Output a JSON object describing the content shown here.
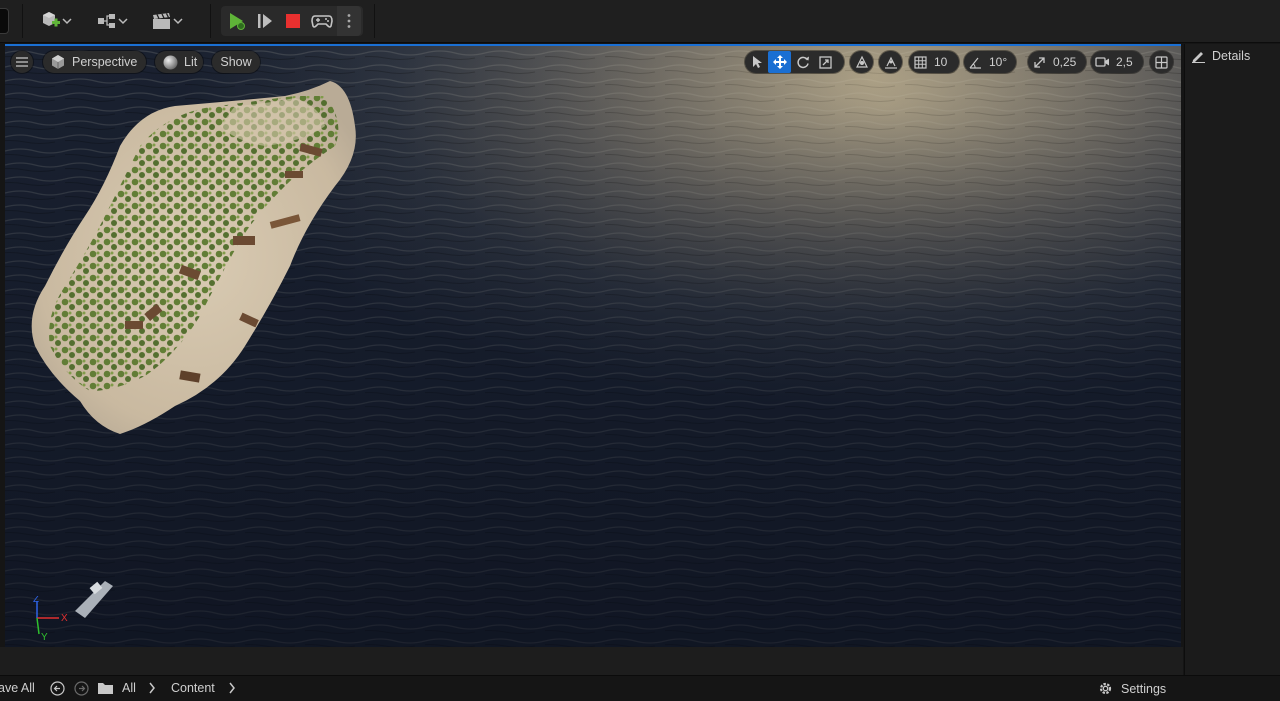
{
  "toolbar": {
    "play_group_icons": [
      "play-icon",
      "advance-frame-icon",
      "stop-icon",
      "gamepad-icon",
      "more-options-icon"
    ]
  },
  "viewport": {
    "perspective_label": "Perspective",
    "lit_label": "Lit",
    "show_label": "Show",
    "grid_snap_value": "10",
    "rotation_snap_value": "10°",
    "scale_snap_value": "0,25",
    "camera_speed_value": "2,5",
    "axis_labels": {
      "z": "Z",
      "x": "X",
      "y": "Y"
    }
  },
  "details": {
    "title": "Details"
  },
  "bottom_bar": {
    "save_all_label": "ave All",
    "breadcrumb_all": "All",
    "breadcrumb_content": "Content",
    "settings_label": "Settings"
  },
  "colors": {
    "accent": "#1a6fd3",
    "play_green": "#5fb438",
    "stop_red": "#e8302f"
  }
}
